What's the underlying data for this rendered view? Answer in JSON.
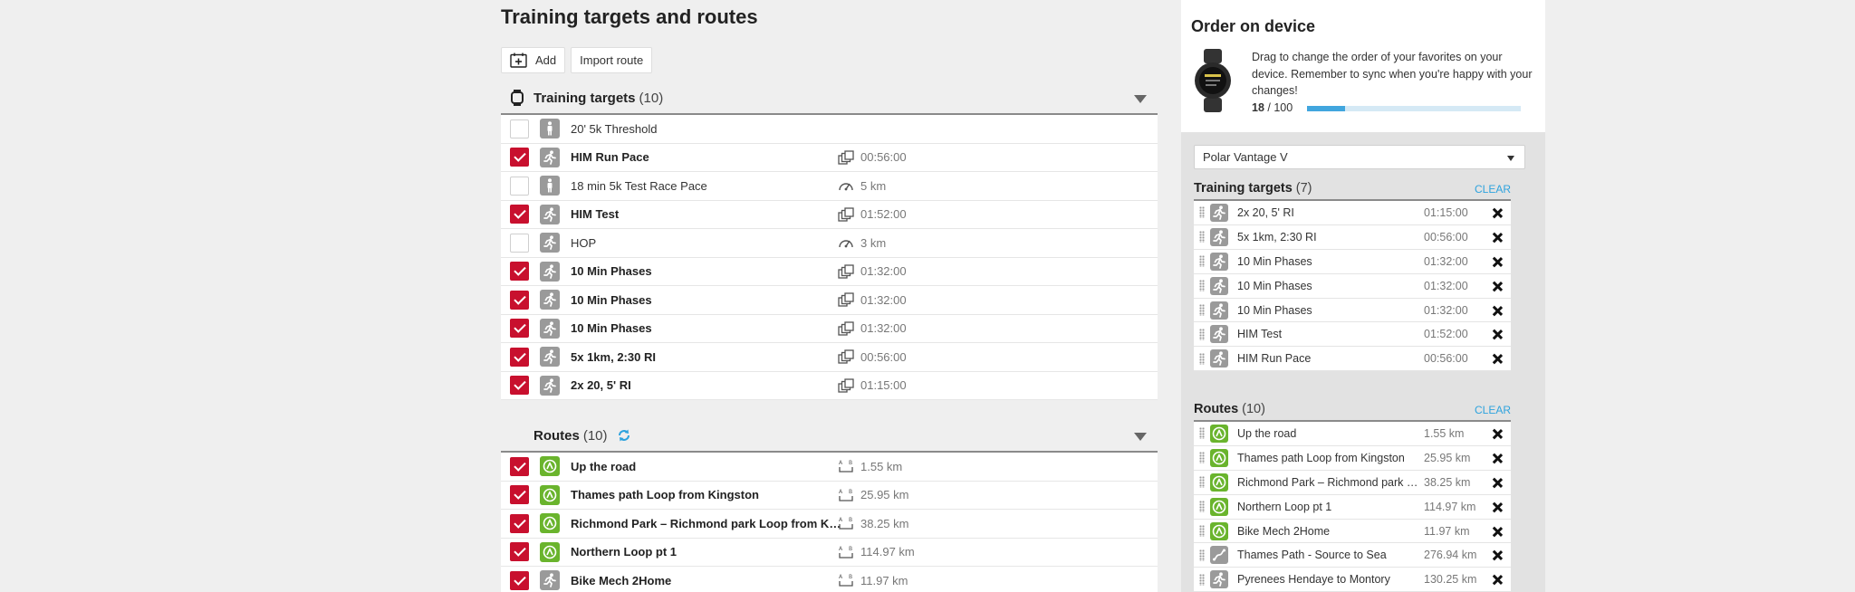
{
  "page": {
    "title": "Training targets and routes"
  },
  "toolbar": {
    "add_label": "Add",
    "import_label": "Import route"
  },
  "training_targets": {
    "title": "Training targets",
    "count": "(10)",
    "rows": [
      {
        "name": "20' 5k Threshold",
        "checked": false,
        "icon": "standing-person-icon",
        "meta_icon": "",
        "value": ""
      },
      {
        "name": "HIM Run Pace",
        "checked": true,
        "icon": "running-person-icon",
        "meta_icon": "phases-icon",
        "value": "00:56:00"
      },
      {
        "name": "18 min 5k Test Race Pace",
        "checked": false,
        "icon": "standing-person-icon",
        "meta_icon": "speedometer-icon",
        "value": "5 km"
      },
      {
        "name": "HIM Test",
        "checked": true,
        "icon": "running-person-icon",
        "meta_icon": "phases-icon",
        "value": "01:52:00"
      },
      {
        "name": "HOP",
        "checked": false,
        "icon": "running-person-icon",
        "meta_icon": "speedometer-icon",
        "value": "3 km"
      },
      {
        "name": "10 Min Phases",
        "checked": true,
        "icon": "running-person-icon",
        "meta_icon": "phases-icon",
        "value": "01:32:00"
      },
      {
        "name": "10 Min Phases",
        "checked": true,
        "icon": "running-person-icon",
        "meta_icon": "phases-icon",
        "value": "01:32:00"
      },
      {
        "name": "10 Min Phases",
        "checked": true,
        "icon": "running-person-icon",
        "meta_icon": "phases-icon",
        "value": "01:32:00"
      },
      {
        "name": "5x 1km, 2:30 RI",
        "checked": true,
        "icon": "running-person-icon",
        "meta_icon": "phases-icon",
        "value": "00:56:00"
      },
      {
        "name": "2x 20, 5' RI",
        "checked": true,
        "icon": "running-person-icon",
        "meta_icon": "phases-icon",
        "value": "01:15:00"
      }
    ]
  },
  "routes": {
    "title": "Routes",
    "count": "(10)",
    "rows": [
      {
        "name": "Up the road",
        "checked": true,
        "icon": "route-icon",
        "meta_icon": "distance-icon",
        "value": "1.55 km"
      },
      {
        "name": "Thames path Loop from Kingston",
        "checked": true,
        "icon": "route-icon",
        "meta_icon": "distance-icon",
        "value": "25.95 km"
      },
      {
        "name": "Richmond Park – Richmond park Loop from Kingston",
        "checked": true,
        "icon": "route-icon",
        "meta_icon": "distance-icon",
        "value": "38.25 km"
      },
      {
        "name": "Northern Loop pt 1",
        "checked": true,
        "icon": "route-icon",
        "meta_icon": "distance-icon",
        "value": "114.97 km"
      },
      {
        "name": "Bike Mech 2Home",
        "checked": true,
        "icon": "running-person-icon",
        "meta_icon": "distance-icon",
        "value": "11.97 km"
      }
    ]
  },
  "order_on_device": {
    "title": "Order on device",
    "description": "Drag to change the order of your favorites on your device. Remember to sync when you're happy with your changes!",
    "used": "18",
    "total": "/ 100",
    "progress": 0.18,
    "device": "Polar Vantage V",
    "clear_label": "CLEAR",
    "targets": {
      "title": "Training targets",
      "count": "(7)",
      "rows": [
        {
          "name": "2x 20, 5' RI",
          "icon": "running-person-icon",
          "value": "01:15:00"
        },
        {
          "name": "5x 1km, 2:30 RI",
          "icon": "running-person-icon",
          "value": "00:56:00"
        },
        {
          "name": "10 Min Phases",
          "icon": "running-person-icon",
          "value": "01:32:00"
        },
        {
          "name": "10 Min Phases",
          "icon": "running-person-icon",
          "value": "01:32:00"
        },
        {
          "name": "10 Min Phases",
          "icon": "running-person-icon",
          "value": "01:32:00"
        },
        {
          "name": "HIM Test",
          "icon": "running-person-icon",
          "value": "01:52:00"
        },
        {
          "name": "HIM Run Pace",
          "icon": "running-person-icon",
          "value": "00:56:00"
        }
      ]
    },
    "routes": {
      "title": "Routes",
      "count": "(10)",
      "rows": [
        {
          "name": "Up the road",
          "icon": "route-icon",
          "value": "1.55 km"
        },
        {
          "name": "Thames path Loop from Kingston",
          "icon": "route-icon",
          "value": "25.95 km"
        },
        {
          "name": "Richmond Park – Richmond park Loop from Kingston",
          "icon": "route-icon",
          "value": "38.25 km"
        },
        {
          "name": "Northern Loop pt 1",
          "icon": "route-icon",
          "value": "114.97 km"
        },
        {
          "name": "Bike Mech 2Home",
          "icon": "route-icon",
          "value": "11.97 km"
        },
        {
          "name": "Thames Path - Source to Sea",
          "icon": "route-gray-icon",
          "value": "276.94 km"
        },
        {
          "name": "Pyrenees Hendaye to Montory",
          "icon": "running-person-icon",
          "value": "130.25 km"
        }
      ]
    }
  },
  "colors": {
    "accent_red": "#c8102e",
    "accent_blue": "#41a6de",
    "route_green": "#6ab42d"
  }
}
